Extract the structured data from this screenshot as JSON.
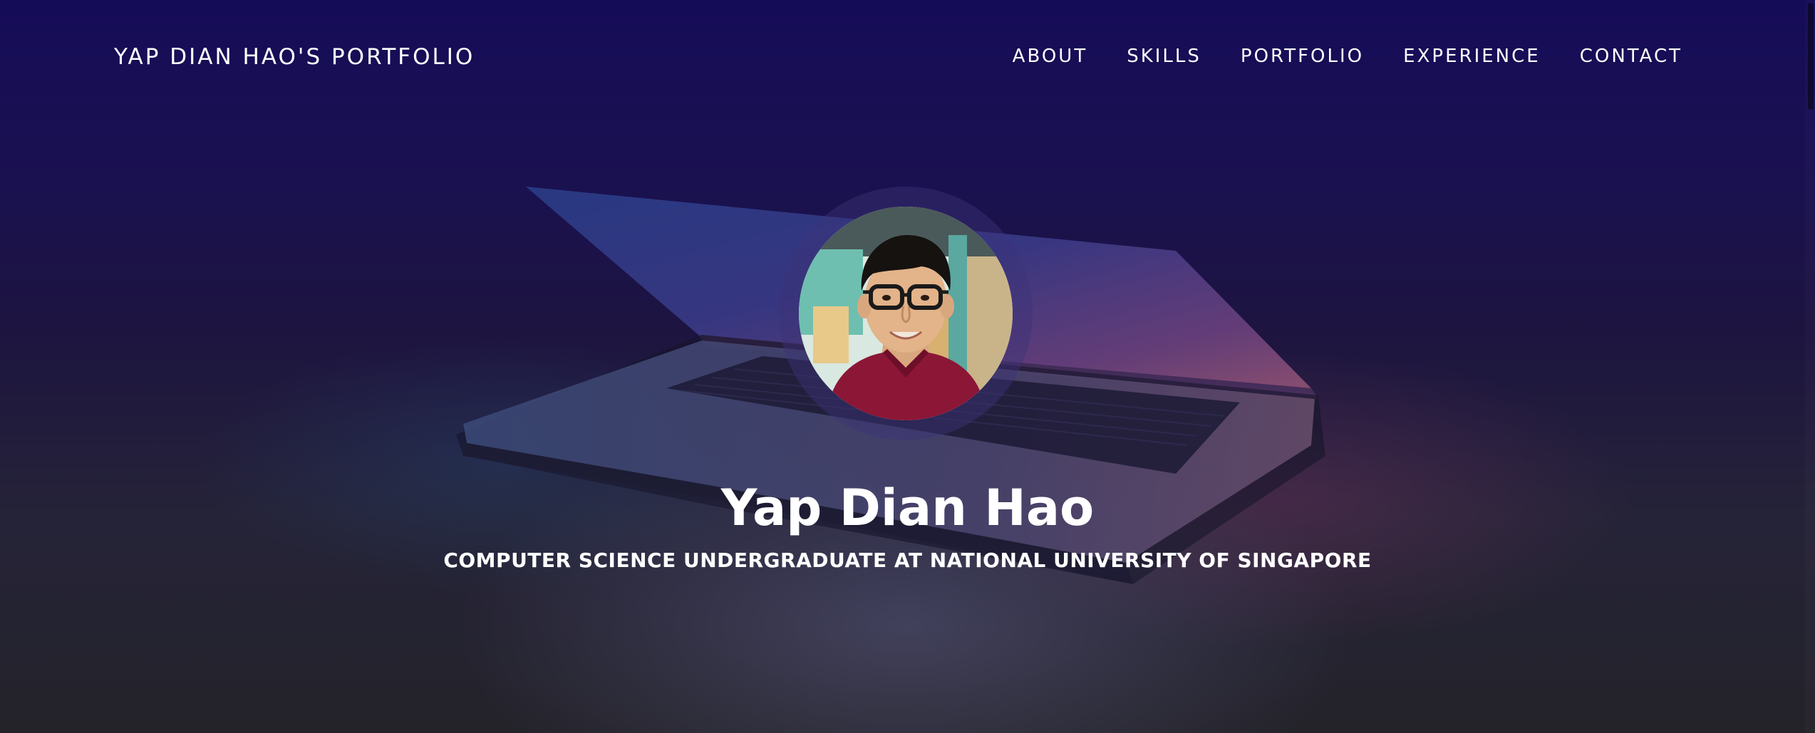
{
  "nav": {
    "brand": "YAP DIAN HAO'S PORTFOLIO",
    "links": [
      "ABOUT",
      "SKILLS",
      "PORTFOLIO",
      "EXPERIENCE",
      "CONTACT"
    ]
  },
  "hero": {
    "name": "Yap Dian Hao",
    "subtitle": "COMPUTER SCIENCE UNDERGRADUATE AT NATIONAL UNIVERSITY OF SINGAPORE"
  },
  "colors": {
    "background_top": "#150c58",
    "background_bottom": "#24232a",
    "text": "#ffffff",
    "shirt": "#8c1636"
  }
}
